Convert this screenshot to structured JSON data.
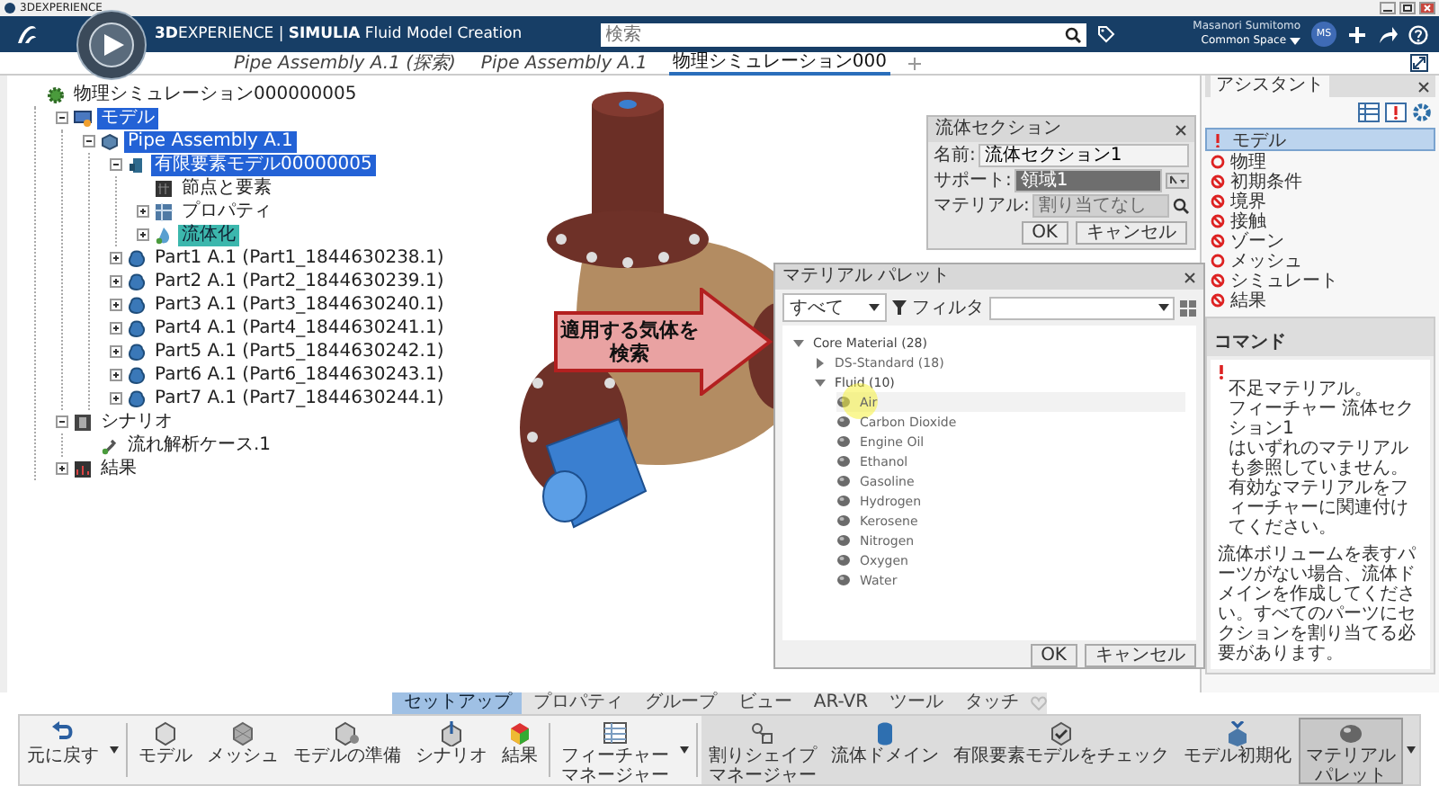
{
  "window": {
    "title": "3DEXPERIENCE"
  },
  "header": {
    "app_title": "**3D**EXPERIENCE | **SIMULIA** Fluid Model Creation",
    "search": {
      "placeholder": "検索"
    },
    "user": {
      "name": "Masanori Sumitomo",
      "space": "Common Space",
      "avatar": "MS"
    }
  },
  "tabs": [
    {
      "label": "Pipe Assembly A.1 (探索)",
      "selected": false
    },
    {
      "label": "Pipe Assembly A.1",
      "selected": false
    },
    {
      "label": "物理シミュレーション000",
      "selected": true
    }
  ],
  "tree": [
    {
      "label": "物理シミュレーション000000005",
      "kind": "simulation",
      "selected": false,
      "children": [
        {
          "label": "モデル",
          "kind": "model",
          "expanded": true,
          "selected": true,
          "children": [
            {
              "label": "Pipe Assembly A.1",
              "kind": "product",
              "expanded": true,
              "selected": true,
              "children": [
                {
                  "label": "有限要素モデル00000005",
                  "kind": "fem",
                  "expanded": true,
                  "selected": true,
                  "children": [
                    {
                      "label": "節点と要素",
                      "kind": "nodes",
                      "selected": false
                    },
                    {
                      "label": "プロパティ",
                      "kind": "properties",
                      "expanded": false,
                      "selected": false
                    },
                    {
                      "label": "流体化",
                      "kind": "section",
                      "expanded": false,
                      "selected": false,
                      "preselected": true
                    }
                  ]
                },
                {
                  "label": "Part1 A.1 (Part1_1844630238.1)",
                  "kind": "part",
                  "expanded": false,
                  "selected": false
                },
                {
                  "label": "Part2 A.1 (Part2_1844630239.1)",
                  "kind": "part",
                  "expanded": false,
                  "selected": false
                },
                {
                  "label": "Part3 A.1 (Part3_1844630240.1)",
                  "kind": "part",
                  "expanded": false,
                  "selected": false
                },
                {
                  "label": "Part4 A.1 (Part4_1844630241.1)",
                  "kind": "part",
                  "expanded": false,
                  "selected": false
                },
                {
                  "label": "Part5 A.1 (Part5_1844630242.1)",
                  "kind": "part",
                  "expanded": false,
                  "selected": false
                },
                {
                  "label": "Part6 A.1 (Part6_1844630243.1)",
                  "kind": "part",
                  "expanded": false,
                  "selected": false
                },
                {
                  "label": "Part7 A.1 (Part7_1844630244.1)",
                  "kind": "part",
                  "expanded": false,
                  "selected": false
                }
              ]
            }
          ]
        },
        {
          "label": "シナリオ",
          "kind": "scenario",
          "expanded": true,
          "selected": false,
          "children": [
            {
              "label": "流れ解析ケース.1",
              "kind": "case",
              "selected": false
            }
          ]
        },
        {
          "label": "結果",
          "kind": "results",
          "expanded": false,
          "selected": false
        }
      ]
    }
  ],
  "callout": "適用する気体を検索",
  "fluid_section": {
    "title": "流体セクション",
    "fields": [
      {
        "label": "名前:",
        "value": "流体セクション1",
        "kind": "text"
      },
      {
        "label": "サポート:",
        "value": "領域1",
        "kind": "select"
      },
      {
        "label": "マテリアル:",
        "placeholder": "割り当てなし",
        "kind": "lookup"
      }
    ],
    "buttons": [
      "OK",
      "キャンセル"
    ]
  },
  "material_palette": {
    "title": "マテリアル パレット",
    "scope": "すべて",
    "filter_label": "フィルタ",
    "tree": [
      {
        "label": "Core Material (28)",
        "expanded": true,
        "selected": false,
        "children": [
          {
            "label": "DS-Standard (18)",
            "expanded": false,
            "selected": false
          },
          {
            "label": "Fluid (10)",
            "expanded": true,
            "selected": false,
            "children": [
              {
                "label": "Air",
                "selected": true
              },
              {
                "label": "Carbon Dioxide",
                "selected": false
              },
              {
                "label": "Engine Oil",
                "selected": false
              },
              {
                "label": "Ethanol",
                "selected": false
              },
              {
                "label": "Gasoline",
                "selected": false
              },
              {
                "label": "Hydrogen",
                "selected": false
              },
              {
                "label": "Kerosene",
                "selected": false
              },
              {
                "label": "Nitrogen",
                "selected": false
              },
              {
                "label": "Oxygen",
                "selected": false
              },
              {
                "label": "Water",
                "selected": false
              }
            ]
          }
        ]
      }
    ],
    "buttons": [
      "OK",
      "キャンセル"
    ]
  },
  "assistant": {
    "title": "アシスタント",
    "steps": [
      {
        "label": "モデル",
        "kind": "warning",
        "selected": true
      },
      {
        "label": "物理",
        "kind": "todo",
        "selected": false
      },
      {
        "label": "初期条件",
        "kind": "blocked",
        "selected": false
      },
      {
        "label": "境界",
        "kind": "blocked",
        "selected": false
      },
      {
        "label": "接触",
        "kind": "blocked",
        "selected": false
      },
      {
        "label": "ゾーン",
        "kind": "blocked",
        "selected": false
      },
      {
        "label": "メッシュ",
        "kind": "todo",
        "selected": false
      },
      {
        "label": "シミュレート",
        "kind": "blocked",
        "selected": false
      },
      {
        "label": "結果",
        "kind": "blocked",
        "selected": false
      }
    ],
    "commands": {
      "title": "コマンド",
      "alert_lines": [
        "不足マテリアル。",
        "フィーチャー 流体セクション1",
        "はいずれのマテリアルも参照していません。",
        "有効なマテリアルをフィーチャーに関連付けてください。"
      ],
      "note": "流体ボリュームを表すパーツがない場合、流体ドメインを作成してください。すべてのパーツにセクションを割り当てる必要があります。"
    }
  },
  "section_tabs": [
    {
      "label": "セットアップ",
      "selected": true
    },
    {
      "label": "プロパティ",
      "selected": false
    },
    {
      "label": "グループ",
      "selected": false
    },
    {
      "label": "ビュー",
      "selected": false
    },
    {
      "label": "AR-VR",
      "selected": false
    },
    {
      "label": "ツール",
      "selected": false
    },
    {
      "label": "タッチ",
      "selected": false
    }
  ],
  "toolbar": [
    [
      {
        "lines": [
          "元に戻す"
        ],
        "menu": true,
        "selected": false
      }
    ],
    [
      {
        "lines": [
          "モデル"
        ],
        "menu": false,
        "selected": false
      },
      {
        "lines": [
          "メッシュ"
        ],
        "menu": false,
        "selected": false
      },
      {
        "lines": [
          "モデルの準備"
        ],
        "menu": false,
        "selected": false
      },
      {
        "lines": [
          "シナリオ"
        ],
        "menu": false,
        "selected": false
      },
      {
        "lines": [
          "結果"
        ],
        "menu": false,
        "selected": false
      }
    ],
    [
      {
        "lines": [
          "フィーチャー",
          "マネージャー"
        ],
        "menu": true,
        "selected": false
      }
    ],
    [
      {
        "lines": [
          "割りシェイプ",
          "マネージャー"
        ],
        "menu": false,
        "selected": false
      },
      {
        "lines": [
          "流体ドメイン"
        ],
        "menu": false,
        "selected": false
      },
      {
        "lines": [
          "有限要素モデルをチェック"
        ],
        "menu": false,
        "selected": false
      },
      {
        "lines": [
          "モデル初期化"
        ],
        "menu": false,
        "selected": false
      },
      {
        "lines": [
          "マテリアル",
          "パレット"
        ],
        "menu": true,
        "selected": true
      }
    ]
  ]
}
